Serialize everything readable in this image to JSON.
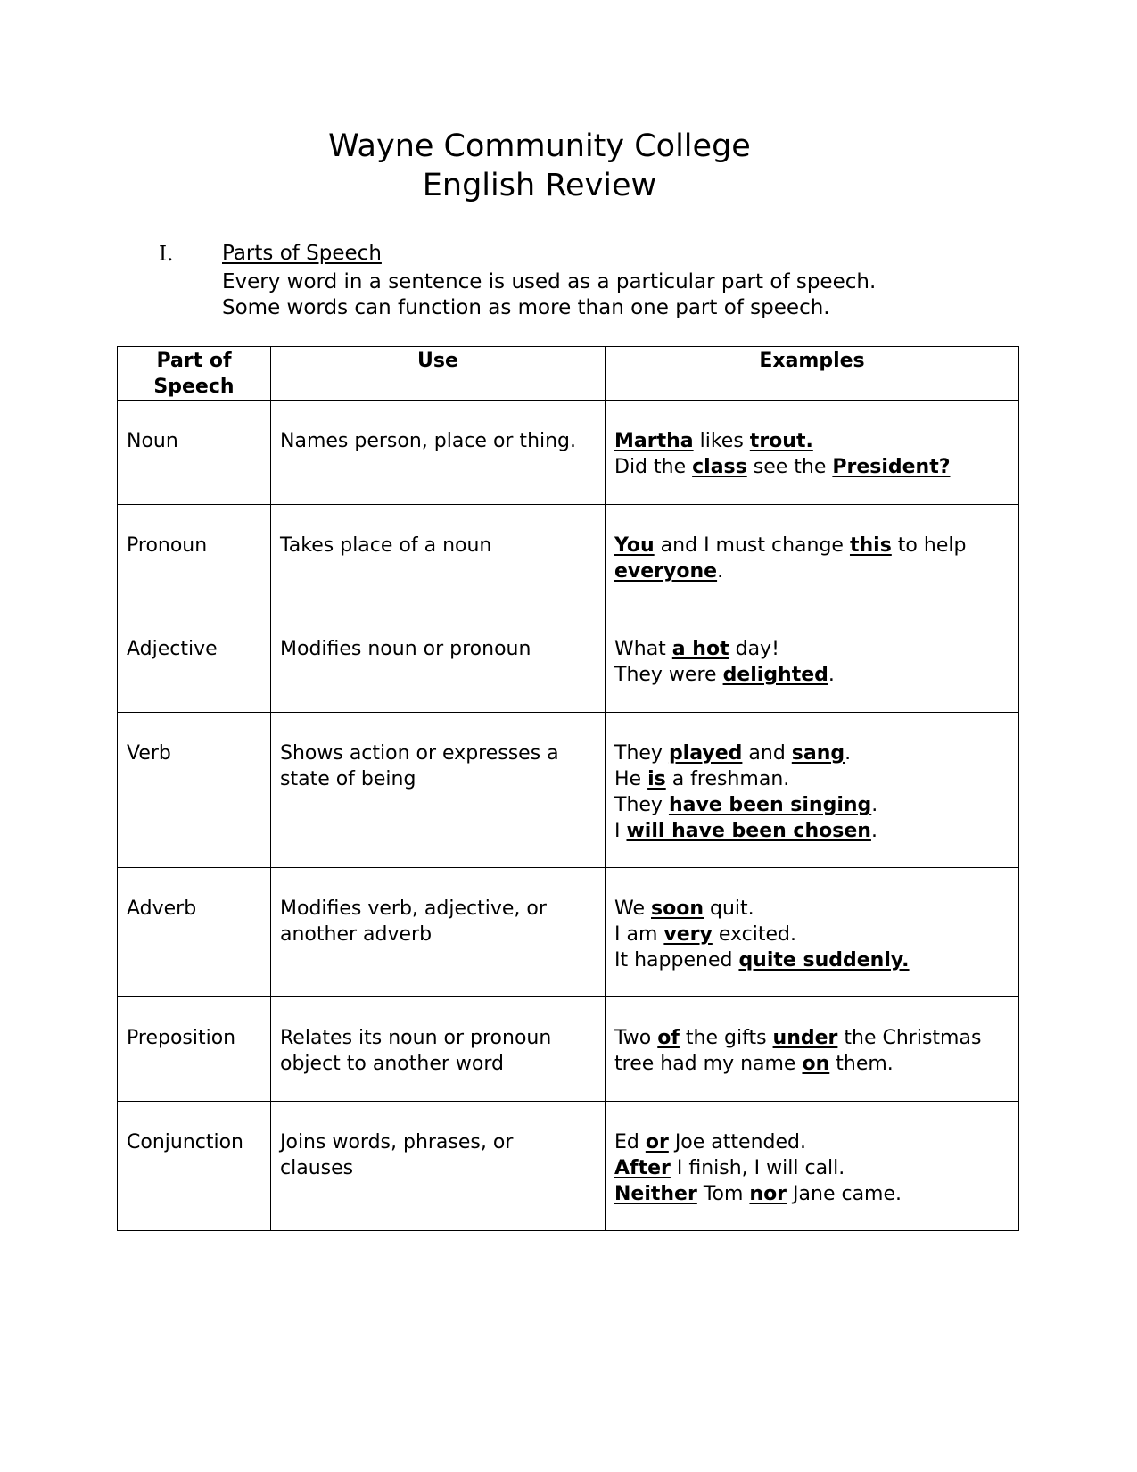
{
  "document": {
    "title_line1": "Wayne Community College",
    "title_line2": "English Review",
    "section": {
      "number": "I.",
      "title": "Parts of Speech",
      "intro": [
        "Every word in a sentence is used as a particular part of speech.",
        "Some words can function as more than one part of speech."
      ]
    },
    "table": {
      "headers": [
        "Part of Speech",
        "Use",
        "Examples"
      ],
      "header_part_lines": [
        "Part of",
        "Speech"
      ],
      "rows": [
        {
          "part": "Noun",
          "use": [
            "Names person, place or thing."
          ],
          "examples": [
            [
              {
                "t": "Martha",
                "em": true
              },
              {
                "t": " likes "
              },
              {
                "t": "trout.",
                "em": true
              }
            ],
            [
              {
                "t": "Did the "
              },
              {
                "t": "class",
                "em": true
              },
              {
                "t": " see the "
              },
              {
                "t": "President?",
                "em": true
              }
            ]
          ]
        },
        {
          "part": "Pronoun",
          "use": [
            "Takes place of a noun"
          ],
          "examples": [
            [
              {
                "t": "You",
                "em": true
              },
              {
                "t": " and I must change "
              },
              {
                "t": "this",
                "em": true
              },
              {
                "t": " to help"
              }
            ],
            [
              {
                "t": "everyone",
                "em": true
              },
              {
                "t": "."
              }
            ]
          ]
        },
        {
          "part": "Adjective",
          "use": [
            "Modifies noun or pronoun"
          ],
          "examples": [
            [
              {
                "t": "What "
              },
              {
                "t": "a hot",
                "em": true
              },
              {
                "t": " day!"
              }
            ],
            [
              {
                "t": "They were "
              },
              {
                "t": "delighted",
                "em": true
              },
              {
                "t": "."
              }
            ]
          ]
        },
        {
          "part": "Verb",
          "use": [
            "Shows action or expresses a",
            "state of being"
          ],
          "examples": [
            [
              {
                "t": "They "
              },
              {
                "t": "played",
                "em": true
              },
              {
                "t": " and "
              },
              {
                "t": "sang",
                "em": true
              },
              {
                "t": "."
              }
            ],
            [
              {
                "t": "He "
              },
              {
                "t": "is",
                "em": true
              },
              {
                "t": " a freshman."
              }
            ],
            [
              {
                "t": "They "
              },
              {
                "t": "have been singing",
                "em": true
              },
              {
                "t": "."
              }
            ],
            [
              {
                "t": "I "
              },
              {
                "t": "will have been chosen",
                "em": true
              },
              {
                "t": "."
              }
            ]
          ]
        },
        {
          "part": "Adverb",
          "use": [
            "Modifies verb, adjective, or",
            "another adverb"
          ],
          "examples": [
            [
              {
                "t": "We "
              },
              {
                "t": "soon",
                "em": true
              },
              {
                "t": " quit."
              }
            ],
            [
              {
                "t": "I am "
              },
              {
                "t": "very",
                "em": true
              },
              {
                "t": " excited."
              }
            ],
            [
              {
                "t": "It happened "
              },
              {
                "t": "quite suddenly.",
                "em": true
              }
            ]
          ]
        },
        {
          "part": "Preposition",
          "use": [
            "Relates its noun or pronoun",
            "object to another word"
          ],
          "examples": [
            [
              {
                "t": "Two "
              },
              {
                "t": "of",
                "em": true
              },
              {
                "t": " the gifts "
              },
              {
                "t": "under",
                "em": true
              },
              {
                "t": " the Christmas"
              }
            ],
            [
              {
                "t": "tree had my name "
              },
              {
                "t": "on",
                "em": true
              },
              {
                "t": " them."
              }
            ]
          ]
        },
        {
          "part": "Conjunction",
          "use": [
            "Joins words, phrases, or",
            "clauses"
          ],
          "examples": [
            [
              {
                "t": "Ed "
              },
              {
                "t": "or",
                "em": true
              },
              {
                "t": " Joe attended."
              }
            ],
            [
              {
                "t": "After",
                "em": true
              },
              {
                "t": " I finish, I will call."
              }
            ],
            [
              {
                "t": "Neither",
                "em": true
              },
              {
                "t": " Tom "
              },
              {
                "t": "nor",
                "em": true
              },
              {
                "t": " Jane came."
              }
            ]
          ]
        }
      ]
    }
  }
}
